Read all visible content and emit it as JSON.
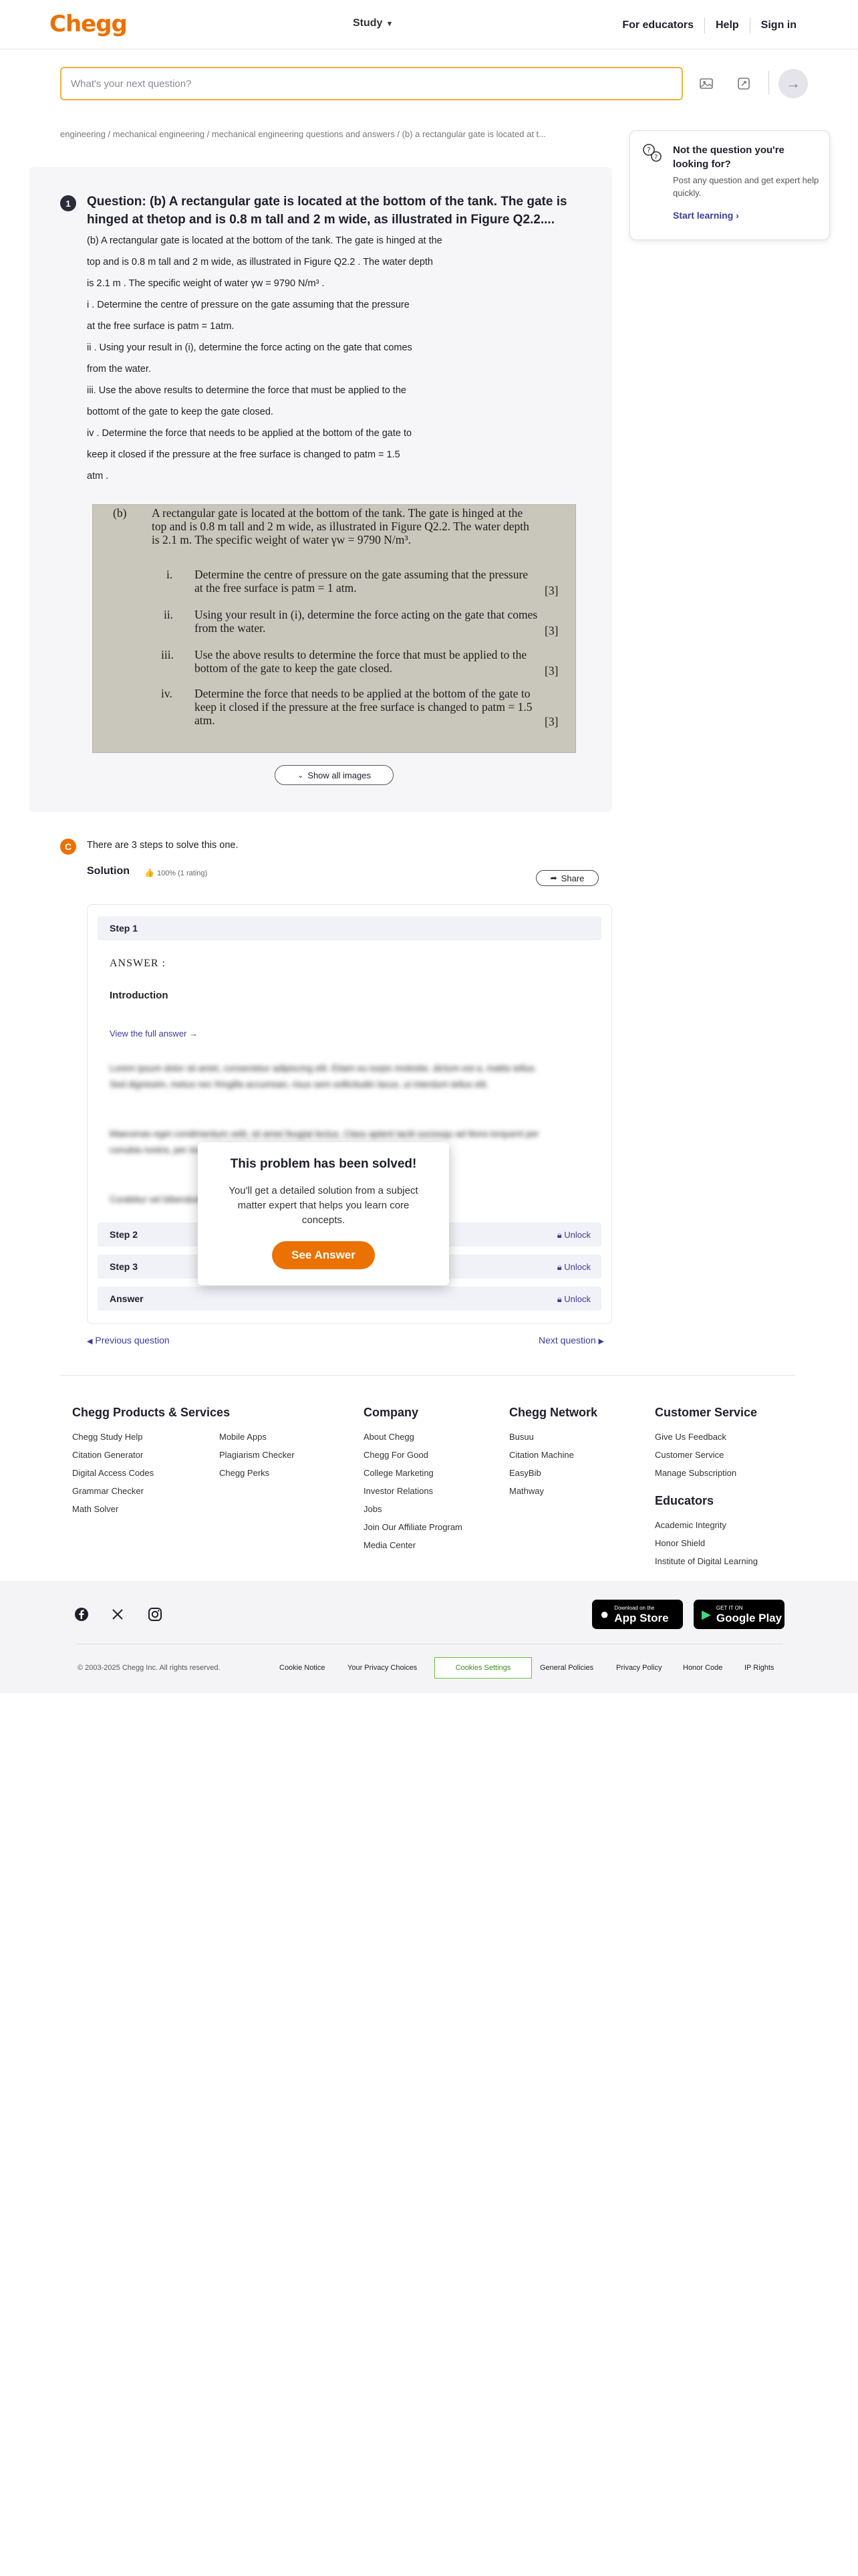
{
  "header": {
    "logo": "Chegg",
    "study_menu": "Study",
    "for_educators": "For educators",
    "help": "Help",
    "sign_in": "Sign in"
  },
  "search": {
    "placeholder": "What's your next question?"
  },
  "breadcrumb": "engineering / mechanical engineering / mechanical engineering questions and answers / (b) a rectangular gate is located at t...",
  "promo": {
    "title": "Not the question you're looking for?",
    "text": "Post any question and get expert help quickly.",
    "link": "Start learning"
  },
  "question": {
    "number": "1",
    "title": "Question: (b) A rectangular gate is located at the bottom of the tank. The gate is hinged at thetop and is 0.8 m tall and 2 m wide, as illustrated in Figure Q2.2....",
    "lines": [
      "(b) A rectangular gate is located at the bottom of the tank. The gate is hinged at the",
      "top and is 0.8 m tall and 2 m wide, as illustrated in Figure Q2.2 . The water depth",
      "is 2.1 m . The specific weight of water γw = 9790 N/m³ .",
      "i . Determine the centre of pressure on the gate assuming that the pressure",
      "at the free surface is patm = 1atm.",
      "ii . Using your result in (i), determine the force acting on the gate that comes",
      "from the water.",
      "iii. Use the above results to determine the force that must be applied to the",
      "bottomt of the gate to keep the gate closed.",
      "iv . Determine the force that needs to be applied at the bottom of the gate to",
      "keep it closed if the pressure at the free surface is changed to patm = 1.5",
      "atm ."
    ]
  },
  "scan": {
    "label": "(b)",
    "intro": [
      "A rectangular gate is located at the bottom of the tank. The gate is hinged at the",
      "top and is 0.8 m tall and 2 m wide, as illustrated in Figure Q2.2. The water depth",
      "is 2.1 m. The specific weight of water γw = 9790 N/m³."
    ],
    "items": [
      {
        "num": "i.",
        "lines": [
          "Determine the centre of pressure on the gate assuming that the pressure",
          "at the free surface is patm = 1 atm."
        ],
        "marks": "[3]"
      },
      {
        "num": "ii.",
        "lines": [
          "Using your result in (i), determine the force acting on the gate that comes",
          "from the water."
        ],
        "marks": "[3]"
      },
      {
        "num": "iii.",
        "lines": [
          "Use the above results to determine the force that must be applied to the",
          "bottom of the gate to keep the gate closed."
        ],
        "marks": "[3]"
      },
      {
        "num": "iv.",
        "lines": [
          "Determine the force that needs to be applied at the bottom of the gate to",
          "keep it closed if the pressure at the free surface is changed to patm = 1.5",
          "atm."
        ],
        "marks": "[3]"
      }
    ]
  },
  "show_images": "Show all images",
  "solution": {
    "badge": "C",
    "steps_text": "There are 3 steps to solve this one.",
    "label": "Solution",
    "rating": "100% (1 rating)",
    "share": "Share",
    "step1": "Step 1",
    "answer_label": "ANSWER :",
    "intro_label": "Introduction",
    "full_answer": "View the full answer →",
    "blur1": "Lorem ipsum dolor sit amet, consectetur adipiscing elit. Etiam eu turpis molestie, dictum est a, mattis tellus. Sed dignissim, metus nec fringilla accumsan, risus sem sollicitudin lacus, ut interdum tellus elit.",
    "blur2": "Maecenas eget condimentum velit, sit amet feugiat lectus. Class aptent taciti sociosqu ad litora torquent per conubia nostra, per inceptos himenaeos. Praesent auctor purus luctus enim egestas.",
    "blur3": "Curabitur vel bibendum lorem. Morbi convallis convallis diam sit amet lacinia.",
    "step2": "Step 2",
    "step3": "Step 3",
    "answer": "Answer",
    "unlock": "Unlock",
    "modal_title": "This problem has been solved!",
    "modal_text": "You'll get a detailed solution from a subject matter expert that helps you learn core concepts.",
    "modal_button": "See Answer",
    "prev": "Previous question",
    "next": "Next question"
  },
  "footer": {
    "col1_title": "Chegg Products & Services",
    "col1_a": [
      "Chegg Study Help",
      "Citation Generator",
      "Digital Access Codes",
      "Grammar Checker",
      "Math Solver"
    ],
    "col1_b": [
      "Mobile Apps",
      "Plagiarism Checker",
      "Chegg Perks"
    ],
    "col2_title": "Company",
    "col2": [
      "About Chegg",
      "Chegg For Good",
      "College Marketing",
      "Investor Relations",
      "Jobs",
      "Join Our Affiliate Program",
      "Media Center"
    ],
    "col3_title": "Chegg Network",
    "col3": [
      "Busuu",
      "Citation Machine",
      "EasyBib",
      "Mathway"
    ],
    "col4_title": "Customer Service",
    "col4": [
      "Give Us Feedback",
      "Customer Service",
      "Manage Subscription"
    ],
    "col5_title": "Educators",
    "col5": [
      "Academic Integrity",
      "Honor Shield",
      "Institute of Digital Learning"
    ],
    "appstore_small": "Download on the",
    "appstore_large": "App Store",
    "googleplay_small": "GET IT ON",
    "googleplay_large": "Google Play",
    "copyright": "© 2003-2025 Chegg Inc. All rights reserved.",
    "legal": [
      "Cookie Notice",
      "Your Privacy Choices",
      "Cookies Settings",
      "General Policies",
      "Privacy Policy",
      "Honor Code",
      "IP Rights"
    ]
  }
}
